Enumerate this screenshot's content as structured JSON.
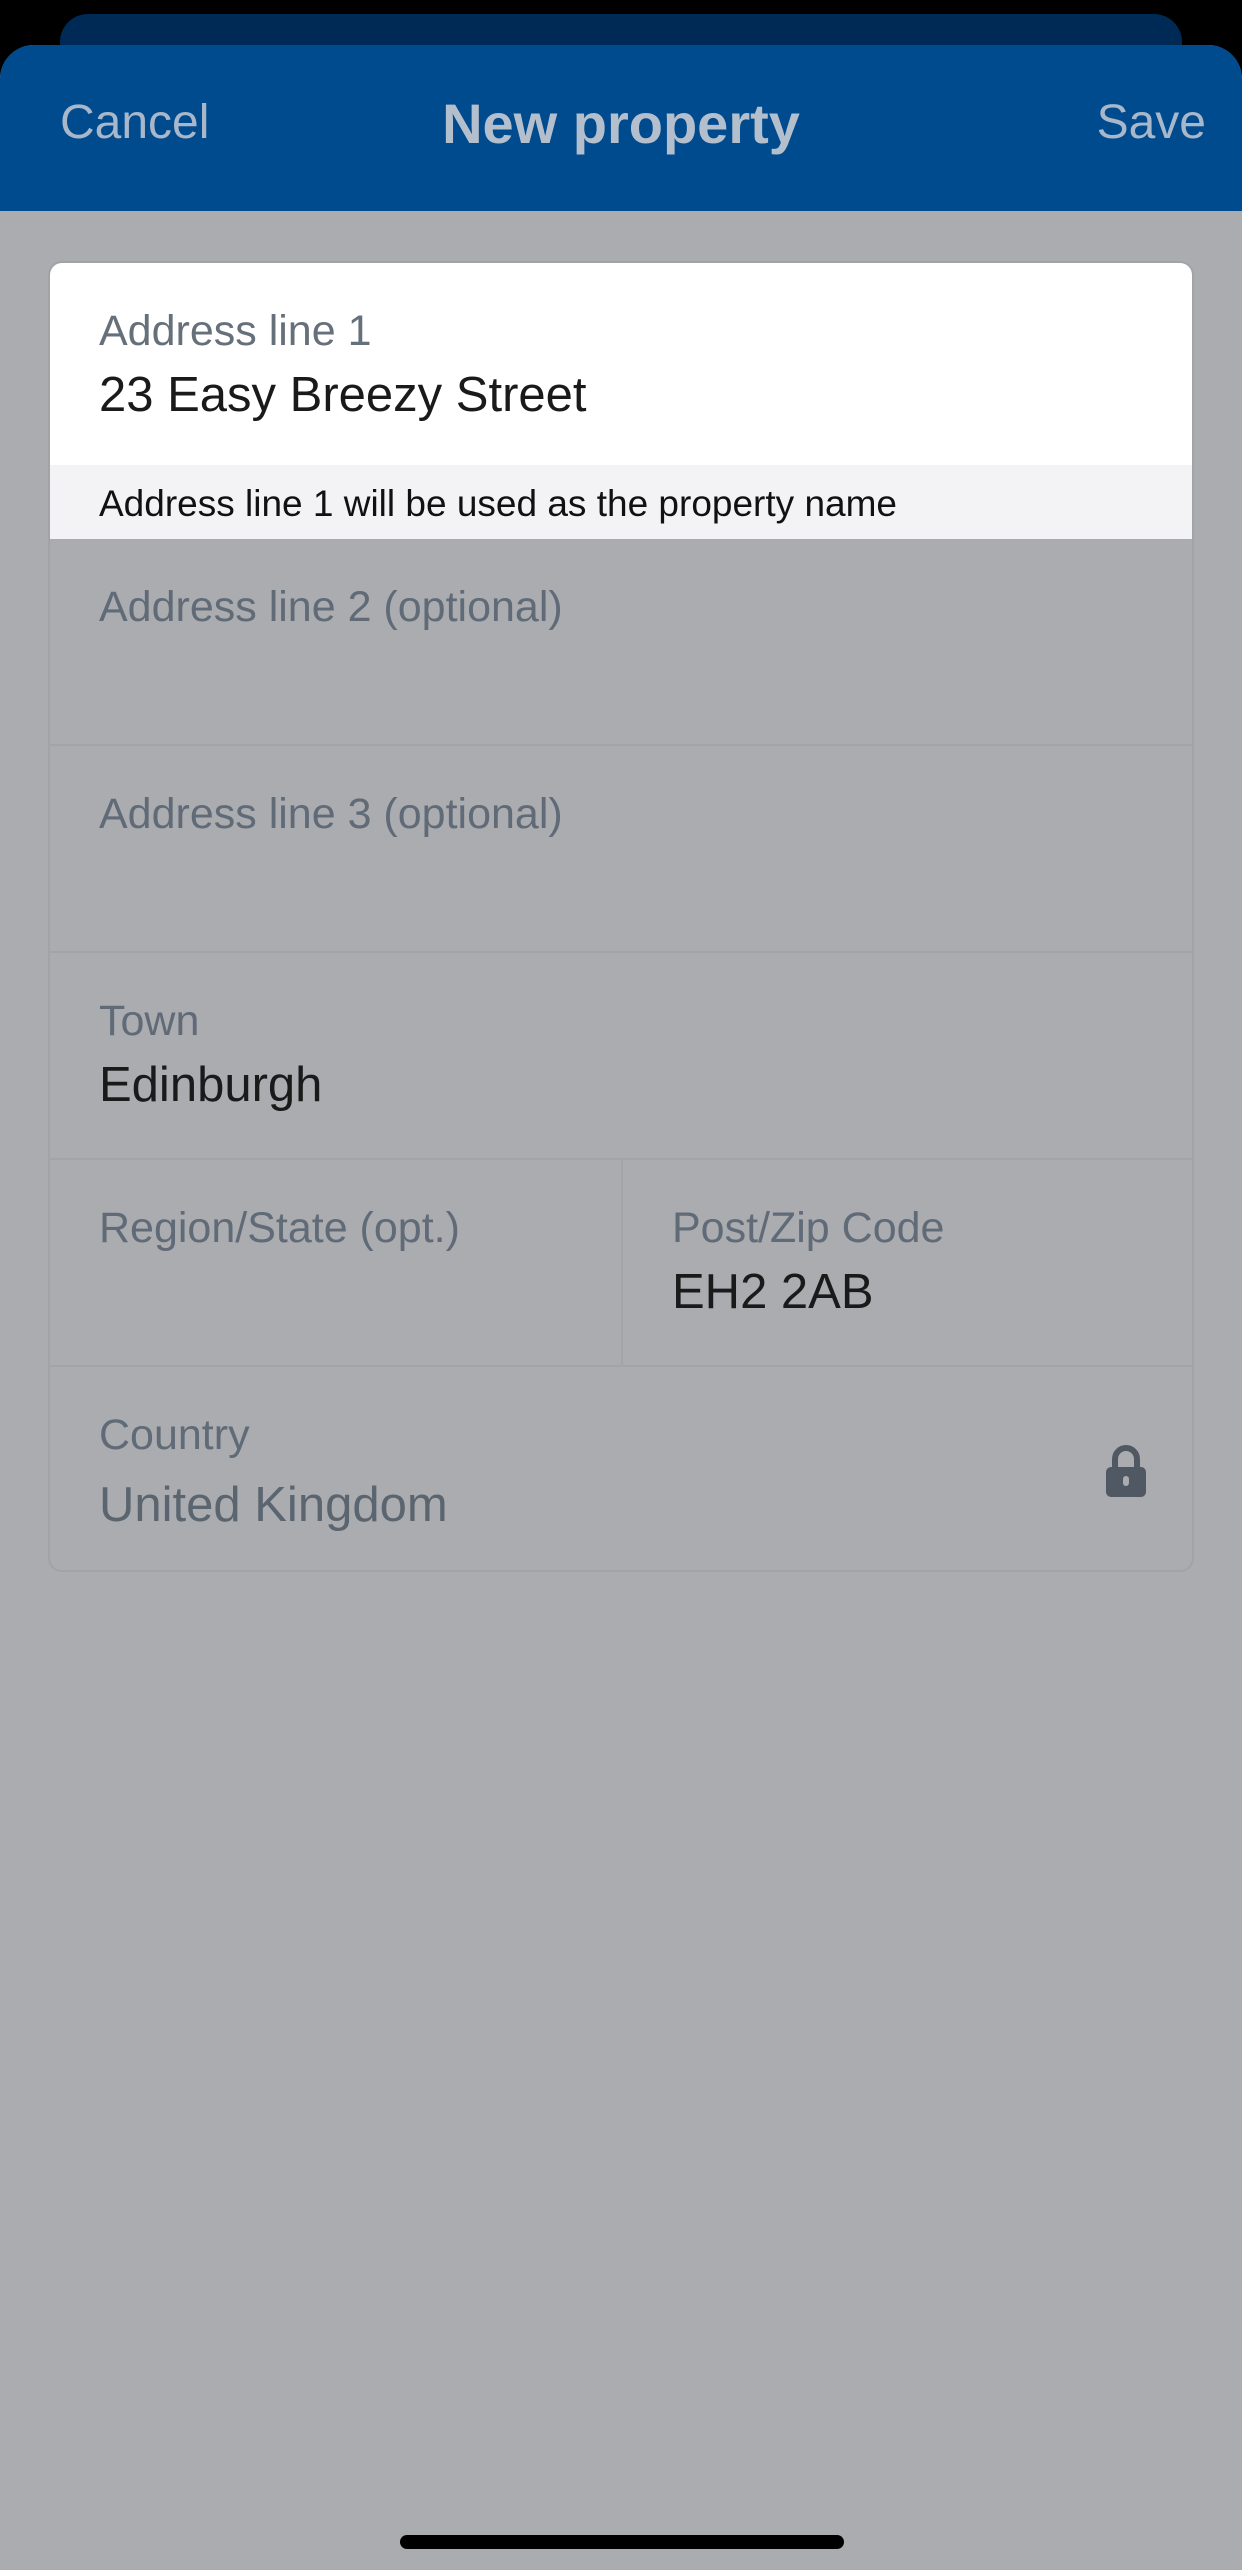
{
  "navbar": {
    "cancel_label": "Cancel",
    "title": "New property",
    "save_label": "Save"
  },
  "form": {
    "address_line_1": {
      "label": "Address line 1",
      "value": "23 Easy Breezy Street"
    },
    "hint": "Address line 1 will be used as the property name",
    "address_line_2": {
      "label": "Address line 2 (optional)",
      "value": ""
    },
    "address_line_3": {
      "label": "Address line 3 (optional)",
      "value": ""
    },
    "town": {
      "label": "Town",
      "value": "Edinburgh"
    },
    "region": {
      "label": "Region/State (opt.)",
      "value": ""
    },
    "postcode": {
      "label": "Post/Zip Code",
      "value": "EH2 2AB"
    },
    "country": {
      "label": "Country",
      "value": "United Kingdom",
      "icon": "lock-icon"
    }
  },
  "colors": {
    "navbar": "#004a8e",
    "overlay_background": "#abacb0",
    "active_field": "#ffffff",
    "hint_background": "#f3f3f6"
  }
}
